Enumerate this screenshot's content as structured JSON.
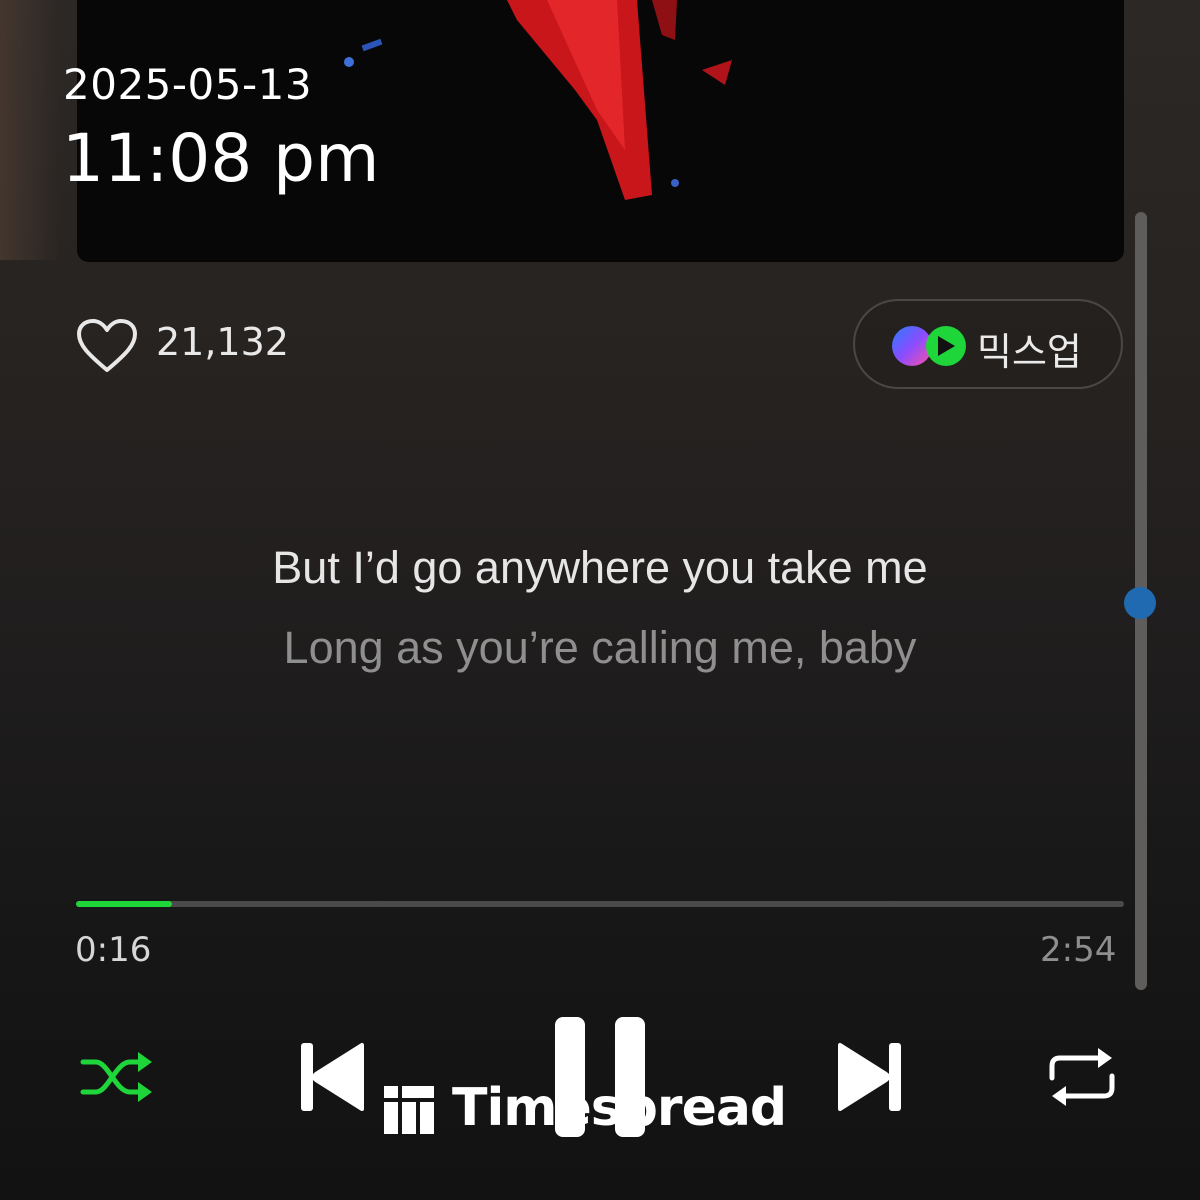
{
  "overlay": {
    "date": "2025-05-13",
    "time": "11:08 pm"
  },
  "track": {
    "like_count": "21,132",
    "mixup_label": "믹스업"
  },
  "lyrics": {
    "current_line": "But I’d go anywhere you take me",
    "next_line": "Long as you’re calling me, baby"
  },
  "playback": {
    "elapsed": "0:16",
    "duration": "2:54",
    "progress_fraction": 0.092,
    "scroll_fraction": 0.5
  },
  "controls": {
    "shuffle": "shuffle-icon",
    "previous": "skip-previous-icon",
    "pause": "pause-icon",
    "next": "skip-next-icon",
    "repeat": "repeat-icon"
  },
  "watermark": {
    "text": "Timespread"
  },
  "colors": {
    "accent_green": "#1ed53a",
    "scroll_thumb": "#1f6ab0"
  }
}
